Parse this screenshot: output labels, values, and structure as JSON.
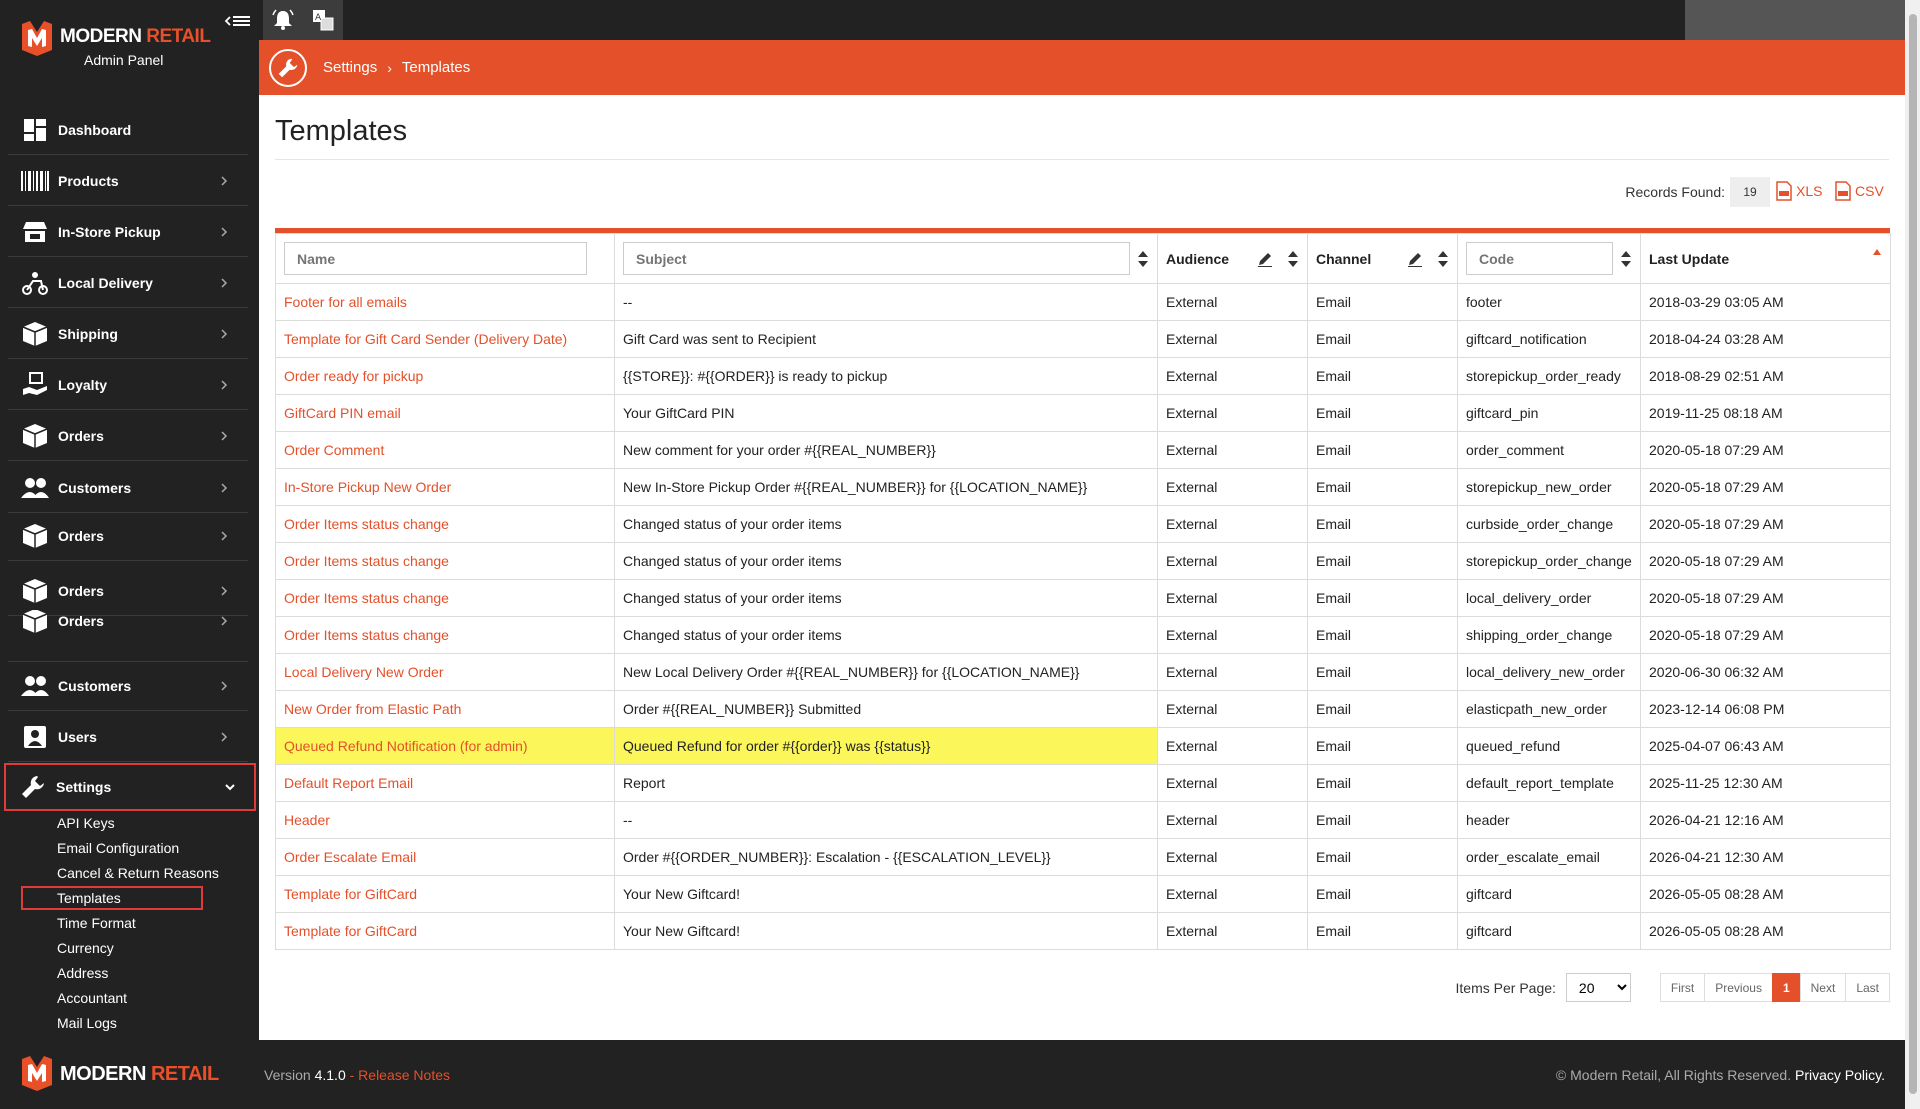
{
  "app": {
    "brand_modern": "MODERN",
    "brand_retail": "RETAIL",
    "subtitle": "Admin Panel"
  },
  "sidebar": {
    "items": [
      {
        "label": "Dashboard",
        "icon": "dashboard-icon"
      },
      {
        "label": "Products",
        "icon": "barcode-icon"
      },
      {
        "label": "In-Store Pickup",
        "icon": "store-icon"
      },
      {
        "label": "Local Delivery",
        "icon": "delivery-icon"
      },
      {
        "label": "Shipping",
        "icon": "box-icon"
      },
      {
        "label": "Loyalty",
        "icon": "loyalty-icon"
      },
      {
        "label": "Orders",
        "icon": "box-icon"
      },
      {
        "label": "Customers",
        "icon": "users-icon"
      },
      {
        "label": "Orders",
        "icon": "box-icon"
      },
      {
        "label": "Orders",
        "icon": "box-icon"
      },
      {
        "label": "Orders",
        "icon": "box-icon"
      },
      {
        "label": "Customers",
        "icon": "users-icon"
      },
      {
        "label": "Users",
        "icon": "user-icon"
      },
      {
        "label": "Settings",
        "icon": "wrench-icon"
      }
    ],
    "settings_sub": [
      "API Keys",
      "Email Configuration",
      "Cancel & Return Reasons",
      "Templates",
      "Time Format",
      "Currency",
      "Address",
      "Accountant",
      "Mail Logs"
    ]
  },
  "breadcrumb": {
    "settings": "Settings",
    "current": "Templates"
  },
  "page": {
    "title": "Templates",
    "records_label": "Records Found:",
    "records_count": "19",
    "xls": "XLS",
    "csv": "CSV"
  },
  "table": {
    "headers": {
      "name_placeholder": "Name",
      "subject_placeholder": "Subject",
      "audience": "Audience",
      "channel": "Channel",
      "code_placeholder": "Code",
      "last_update": "Last Update"
    },
    "rows": [
      {
        "name": "Footer for all emails",
        "subject": "--",
        "audience": "External",
        "channel": "Email",
        "code": "footer",
        "updated": "2018-03-29 03:05 AM"
      },
      {
        "name": "Template for Gift Card Sender (Delivery Date)",
        "subject": "Gift Card was sent to Recipient",
        "audience": "External",
        "channel": "Email",
        "code": "giftcard_notification",
        "updated": "2018-04-24 03:28 AM"
      },
      {
        "name": "Order ready for pickup",
        "subject": "{{STORE}}: #{{ORDER}} is ready to pickup",
        "audience": "External",
        "channel": "Email",
        "code": "storepickup_order_ready",
        "updated": "2018-08-29 02:51 AM"
      },
      {
        "name": "GiftCard PIN email",
        "subject": "Your GiftCard PIN",
        "audience": "External",
        "channel": "Email",
        "code": "giftcard_pin",
        "updated": "2019-11-25 08:18 AM"
      },
      {
        "name": "Order Comment",
        "subject": "New comment for your order #{{REAL_NUMBER}}",
        "audience": "External",
        "channel": "Email",
        "code": "order_comment",
        "updated": "2020-05-18 07:29 AM"
      },
      {
        "name": "In-Store Pickup New Order",
        "subject": "New In-Store Pickup Order #{{REAL_NUMBER}} for {{LOCATION_NAME}}",
        "audience": "External",
        "channel": "Email",
        "code": "storepickup_new_order",
        "updated": "2020-05-18 07:29 AM"
      },
      {
        "name": "Order Items status change",
        "subject": "Changed status of your order items",
        "audience": "External",
        "channel": "Email",
        "code": "curbside_order_change",
        "updated": "2020-05-18 07:29 AM"
      },
      {
        "name": "Order Items status change",
        "subject": "Changed status of your order items",
        "audience": "External",
        "channel": "Email",
        "code": "storepickup_order_change",
        "updated": "2020-05-18 07:29 AM"
      },
      {
        "name": "Order Items status change",
        "subject": "Changed status of your order items",
        "audience": "External",
        "channel": "Email",
        "code": "local_delivery_order",
        "updated": "2020-05-18 07:29 AM"
      },
      {
        "name": "Order Items status change",
        "subject": "Changed status of your order items",
        "audience": "External",
        "channel": "Email",
        "code": "shipping_order_change",
        "updated": "2020-05-18 07:29 AM"
      },
      {
        "name": "Local Delivery New Order",
        "subject": "New Local Delivery Order #{{REAL_NUMBER}} for {{LOCATION_NAME}}",
        "audience": "External",
        "channel": "Email",
        "code": "local_delivery_new_order",
        "updated": "2020-06-30 06:32 AM"
      },
      {
        "name": "New Order from Elastic Path",
        "subject": "Order #{{REAL_NUMBER}} Submitted",
        "audience": "External",
        "channel": "Email",
        "code": "elasticpath_new_order",
        "updated": "2023-12-14 06:08 PM"
      },
      {
        "name": "Queued Refund Notification (for admin)",
        "subject": "Queued Refund for order #{{order}} was {{status}}",
        "audience": "External",
        "channel": "Email",
        "code": "queued_refund",
        "updated": "2025-04-07 06:43 AM"
      },
      {
        "name": "Default Report Email",
        "subject": "Report",
        "audience": "External",
        "channel": "Email",
        "code": "default_report_template",
        "updated": "2025-11-25 12:30 AM"
      },
      {
        "name": "Header",
        "subject": "--",
        "audience": "External",
        "channel": "Email",
        "code": "header",
        "updated": "2026-04-21 12:16 AM"
      },
      {
        "name": "Order Escalate Email",
        "subject": "Order #{{ORDER_NUMBER}}: Escalation - {{ESCALATION_LEVEL}}",
        "audience": "External",
        "channel": "Email",
        "code": "order_escalate_email",
        "updated": "2026-04-21 12:30 AM"
      },
      {
        "name": "Template for GiftCard",
        "subject": "Your New Giftcard!",
        "audience": "External",
        "channel": "Email",
        "code": "giftcard",
        "updated": "2026-05-05 08:28 AM"
      },
      {
        "name": "Template for GiftCard",
        "subject": "Your New Giftcard!",
        "audience": "External",
        "channel": "Email",
        "code": "giftcard",
        "updated": "2026-05-05 08:28 AM"
      }
    ]
  },
  "pager": {
    "items_per_page_label": "Items Per Page:",
    "items_per_page": "20",
    "first": "First",
    "previous": "Previous",
    "current": "1",
    "next": "Next",
    "last": "Last"
  },
  "footer": {
    "version_label": "Version",
    "version": "4.1.0",
    "release_notes": "- Release Notes",
    "copyright": "© Modern Retail, All Rights Reserved.",
    "privacy": "Privacy Policy."
  },
  "colors": {
    "accent": "#e4502a",
    "sidebar": "#222222",
    "highlight": "#fbf75a"
  }
}
